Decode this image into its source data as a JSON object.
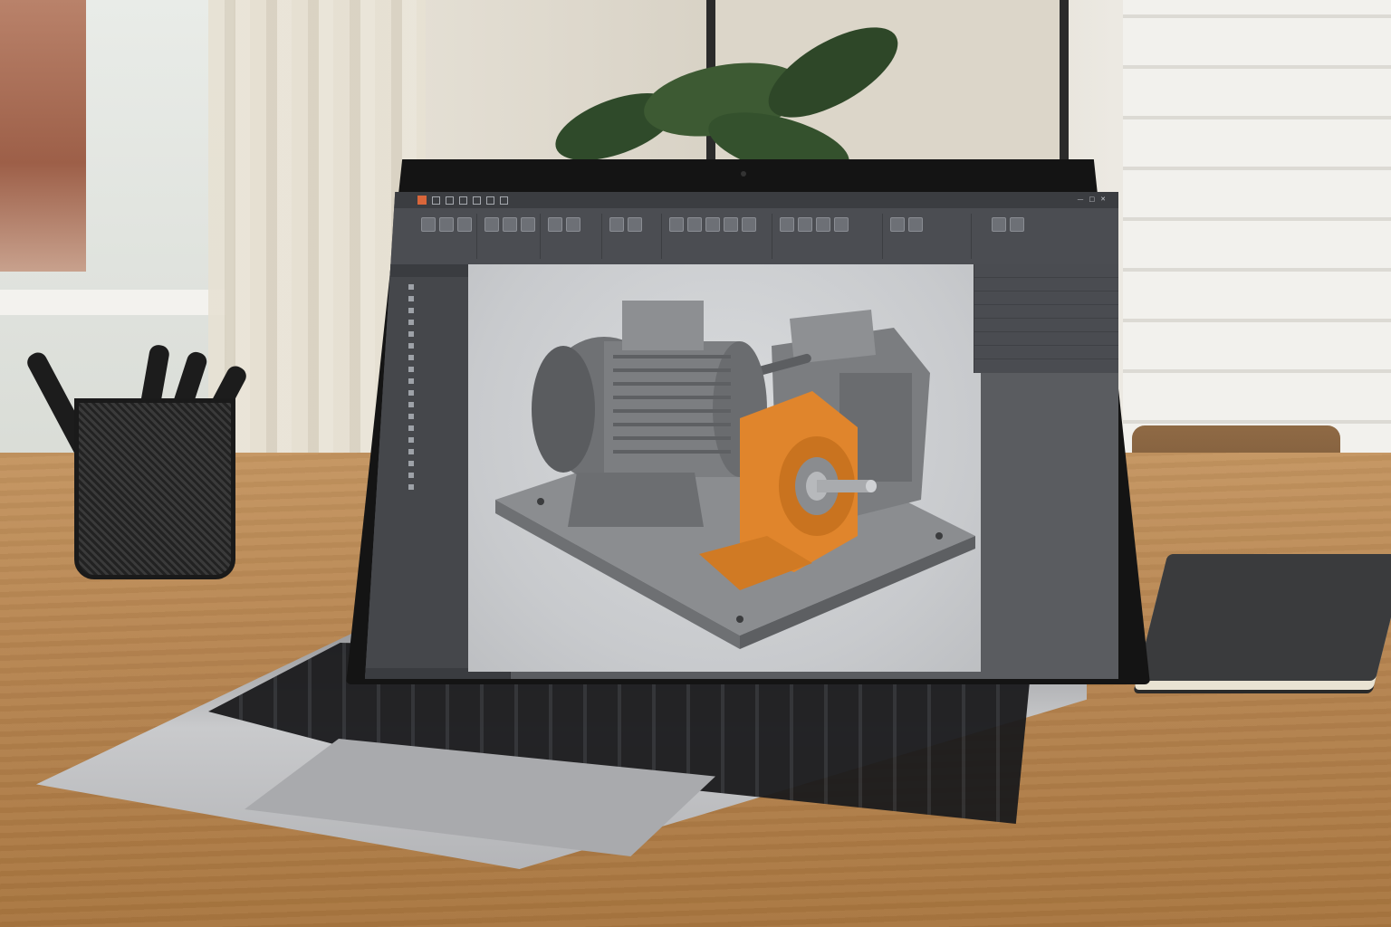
{
  "scene": {
    "description_objects": [
      "laptop",
      "pen-cup",
      "notebook",
      "plant",
      "window",
      "chair"
    ]
  },
  "app": {
    "colors": {
      "chrome": "#3b3d41",
      "ribbon": "#4b4d52",
      "panel": "#45474b",
      "viewport": "#c8cacd",
      "accent": "#d9663a",
      "part_orange": "#e0852c",
      "part_gray": "#7a7c7f"
    },
    "icons": [
      "app-logo-icon",
      "save-icon",
      "undo-icon",
      "redo-icon",
      "close-icon",
      "minimize-icon",
      "maximize-icon"
    ]
  }
}
